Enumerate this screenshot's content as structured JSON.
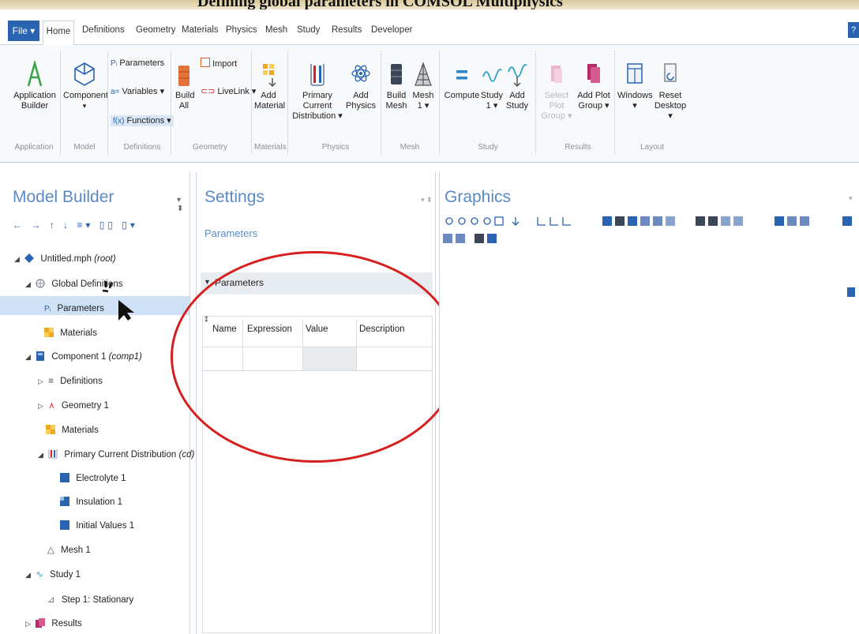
{
  "banner": {
    "text": "Defining global parameters in COMSOL Multiphysics"
  },
  "tabs": {
    "file": "File ▾",
    "items": [
      "Home",
      "Definitions",
      "Geometry",
      "Materials",
      "Physics",
      "Mesh",
      "Study",
      "Results",
      "Developer"
    ],
    "help": "?"
  },
  "ribbon": {
    "application_builder": "Application Builder",
    "component": "Component",
    "parameters": "Parameters",
    "variables": "Variables ▾",
    "functions": "Functions ▾",
    "build_all": "Build All",
    "import": "Import",
    "livelink": "LiveLink ▾",
    "add_material": "Add Material",
    "primary_current": "Primary Current Distribution ▾",
    "add_physics": "Add Physics",
    "build_mesh": "Build Mesh",
    "mesh1": "Mesh 1 ▾",
    "compute": "Compute",
    "study1": "Study 1 ▾",
    "add_study": "Add Study",
    "select_plot_group": "Select Plot Group ▾",
    "add_plot_group": "Add Plot Group ▾",
    "windows": "Windows ▾",
    "reset_desktop": "Reset Desktop ▾",
    "groups": [
      "Application",
      "Model",
      "Definitions",
      "Geometry",
      "Materials",
      "Physics",
      "Mesh",
      "Study",
      "Results",
      "Layout"
    ]
  },
  "model_builder": {
    "title": "Model Builder",
    "tree": [
      {
        "label": "Untitled.mph",
        "suffix": "(root)"
      },
      {
        "label": "Global Definitions",
        "suffix": ""
      },
      {
        "label": "Parameters",
        "suffix": ""
      },
      {
        "label": "Materials",
        "suffix": ""
      },
      {
        "label": "Component 1",
        "suffix": "(comp1)"
      },
      {
        "label": "Definitions",
        "suffix": ""
      },
      {
        "label": "Geometry 1",
        "suffix": ""
      },
      {
        "label": "Materials",
        "suffix": ""
      },
      {
        "label": "Primary Current Distribution",
        "suffix": "(cd)"
      },
      {
        "label": "Electrolyte 1",
        "suffix": ""
      },
      {
        "label": "Insulation 1",
        "suffix": ""
      },
      {
        "label": "Initial Values 1",
        "suffix": ""
      },
      {
        "label": "Mesh 1",
        "suffix": ""
      },
      {
        "label": "Study 1",
        "suffix": ""
      },
      {
        "label": "Step 1: Stationary",
        "suffix": ""
      },
      {
        "label": "Results",
        "suffix": ""
      }
    ]
  },
  "settings": {
    "title": "Settings",
    "subtitle": "Parameters",
    "section": "Parameters",
    "columns": [
      "Name",
      "Expression",
      "Value",
      "Description"
    ]
  },
  "graphics": {
    "title": "Graphics"
  },
  "colors": {
    "accent": "#2a64b1",
    "pane_title": "#5a8ac6",
    "highlight_circle": "#d62020",
    "selection": "#cfe1f7"
  },
  "icons": [
    "pointer-cursor-icon",
    "search-zoom-icon",
    "gear-icon",
    "atom-icon"
  ]
}
